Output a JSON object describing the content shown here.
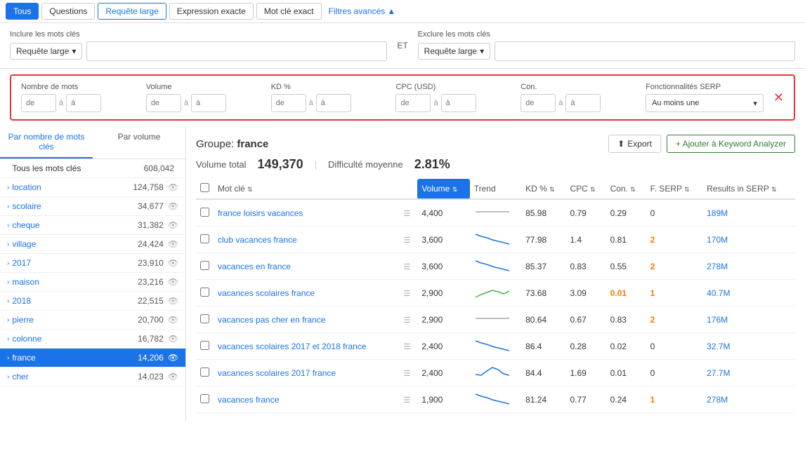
{
  "topBar": {
    "buttons": [
      {
        "label": "Tous",
        "active": true
      },
      {
        "label": "Questions",
        "active": false
      },
      {
        "label": "Requête large",
        "active": true,
        "outline": true
      },
      {
        "label": "Expression exacte",
        "active": false
      },
      {
        "label": "Mot clé exact",
        "active": false
      }
    ],
    "filtresAvances": "Filtres avancés"
  },
  "includeExclude": {
    "includeLabel": "Inclure les mots clés",
    "excludeLabel": "Exclure les mots clés",
    "includeSelect": "Requête large",
    "includeInputPlaceholder": "",
    "etLabel": "ET",
    "excludeSelect": "Requête large",
    "excludeInputPlaceholder": ""
  },
  "advancedFilters": {
    "nombreMots": {
      "label": "Nombre de mots",
      "fromPlaceholder": "de",
      "toPlaceholder": "à"
    },
    "volume": {
      "label": "Volume",
      "fromPlaceholder": "de",
      "toPlaceholder": "à"
    },
    "kd": {
      "label": "KD %",
      "fromPlaceholder": "de",
      "toPlaceholder": "à"
    },
    "cpc": {
      "label": "CPC (USD)",
      "fromPlaceholder": "de",
      "toPlaceholder": "à"
    },
    "con": {
      "label": "Con.",
      "fromPlaceholder": "de",
      "toPlaceholder": "à"
    },
    "fonctionnalites": {
      "label": "Fonctionnalités SERP",
      "value": "Au moins une"
    }
  },
  "sidebar": {
    "tabs": [
      "Par nombre de mots clés",
      "Par volume"
    ],
    "activeTab": 0,
    "items": [
      {
        "name": "Tous les mots clés",
        "count": "608,042",
        "isHeader": true,
        "active": false
      },
      {
        "name": "location",
        "count": "124,758",
        "active": false
      },
      {
        "name": "scolaire",
        "count": "34,677",
        "active": false
      },
      {
        "name": "cheque",
        "count": "31,382",
        "active": false
      },
      {
        "name": "village",
        "count": "24,424",
        "active": false
      },
      {
        "name": "2017",
        "count": "23,910",
        "active": false
      },
      {
        "name": "maison",
        "count": "23,216",
        "active": false
      },
      {
        "name": "2018",
        "count": "22,515",
        "active": false
      },
      {
        "name": "pierre",
        "count": "20,700",
        "active": false
      },
      {
        "name": "colonne",
        "count": "16,782",
        "active": false
      },
      {
        "name": "france",
        "count": "14,206",
        "active": true
      },
      {
        "name": "cher",
        "count": "14,023",
        "active": false
      }
    ]
  },
  "content": {
    "groupLabel": "Groupe:",
    "groupName": "france",
    "volumeLabel": "Volume total",
    "volumeValue": "149,370",
    "difficulteLabel": "Difficulté moyenne",
    "difficulteValue": "2.81%",
    "exportLabel": "Export",
    "addLabel": "+ Ajouter à Keyword Analyzer",
    "table": {
      "headers": [
        "",
        "Mot clé",
        "",
        "Volume",
        "Trend",
        "KD %",
        "CPC",
        "Con.",
        "F. SERP",
        "Results in SERP"
      ],
      "rows": [
        {
          "keyword": "france loisirs vacances",
          "volume": "4,400",
          "kd": "85.98",
          "cpc": "0.79",
          "con": "0.29",
          "fserp": "0",
          "results": "189M",
          "trend": "flat"
        },
        {
          "keyword": "club vacances france",
          "volume": "3,600",
          "kd": "77.98",
          "cpc": "1.4",
          "con": "0.81",
          "fserp": "2",
          "results": "170M",
          "trend": "down"
        },
        {
          "keyword": "vacances en france",
          "volume": "3,600",
          "kd": "85.37",
          "cpc": "0.83",
          "con": "0.55",
          "fserp": "2",
          "results": "278M",
          "trend": "down"
        },
        {
          "keyword": "vacances scolaires france",
          "volume": "2,900",
          "kd": "73.68",
          "cpc": "3.09",
          "con": "0.01",
          "fserp": "1",
          "results": "40.7M",
          "trend": "up",
          "conOrange": true
        },
        {
          "keyword": "vacances pas cher en france",
          "volume": "2,900",
          "kd": "80.64",
          "cpc": "0.67",
          "con": "0.83",
          "fserp": "2",
          "results": "176M",
          "trend": "flat"
        },
        {
          "keyword": "vacances scolaires 2017 et 2018 france",
          "volume": "2,400",
          "kd": "86.4",
          "cpc": "0.28",
          "con": "0.02",
          "fserp": "0",
          "results": "32.7M",
          "trend": "down"
        },
        {
          "keyword": "vacances scolaires 2017 france",
          "volume": "2,400",
          "kd": "84.4",
          "cpc": "1.69",
          "con": "0.01",
          "fserp": "0",
          "results": "27.7M",
          "trend": "peak"
        },
        {
          "keyword": "vacances france",
          "volume": "1,900",
          "kd": "81.24",
          "cpc": "0.77",
          "con": "0.24",
          "fserp": "1",
          "results": "278M",
          "trend": "down"
        }
      ]
    }
  }
}
